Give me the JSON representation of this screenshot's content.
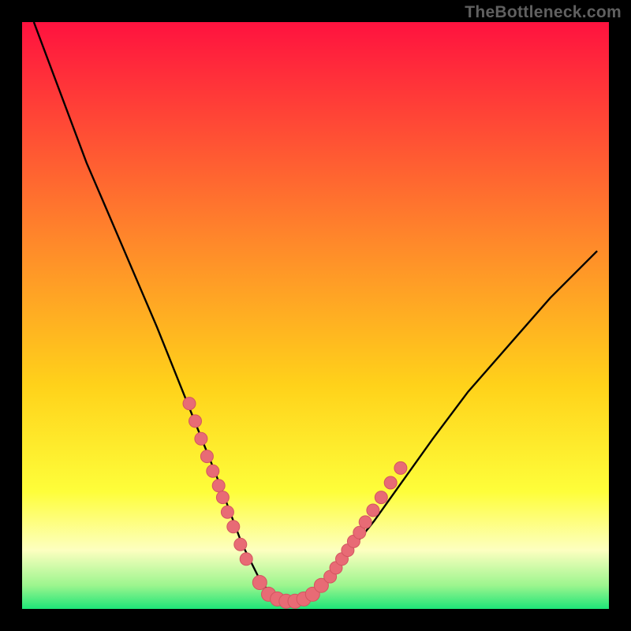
{
  "watermark": "TheBottleneck.com",
  "colors": {
    "gradient_top": "#ff123f",
    "gradient_mid1": "#ff7a2d",
    "gradient_mid2": "#ffd21a",
    "gradient_mid3": "#fefe3a",
    "gradient_pale": "#fdffc0",
    "gradient_green": "#1ee578",
    "curve": "#000000",
    "dot_fill": "#e86b75",
    "dot_stroke": "#d35560"
  },
  "chart_data": {
    "type": "line",
    "title": "",
    "xlabel": "",
    "ylabel": "",
    "xlim": [
      0,
      100
    ],
    "ylim": [
      0,
      100
    ],
    "series": [
      {
        "name": "bottleneck-curve",
        "x": [
          2,
          5,
          8,
          11,
          14,
          17,
          20,
          23,
          25,
          27,
          29,
          31,
          33,
          34.5,
          36,
          37.5,
          39,
          40.5,
          42,
          44,
          46,
          48,
          50,
          53,
          56,
          60,
          65,
          70,
          76,
          83,
          90,
          98
        ],
        "y": [
          100,
          92,
          84,
          76,
          69,
          62,
          55,
          48,
          43,
          38,
          33,
          28,
          23,
          19,
          15,
          11,
          8,
          5,
          3,
          1.5,
          1,
          1.5,
          3,
          6,
          10,
          15,
          22,
          29,
          37,
          45,
          53,
          61
        ]
      }
    ],
    "scatter": [
      {
        "name": "left-branch-dots",
        "points": [
          {
            "x": 28.5,
            "y": 35
          },
          {
            "x": 29.5,
            "y": 32
          },
          {
            "x": 30.5,
            "y": 29
          },
          {
            "x": 31.5,
            "y": 26
          },
          {
            "x": 32.5,
            "y": 23.5
          },
          {
            "x": 33.5,
            "y": 21
          },
          {
            "x": 34.2,
            "y": 19
          },
          {
            "x": 35,
            "y": 16.5
          },
          {
            "x": 36,
            "y": 14
          },
          {
            "x": 37.2,
            "y": 11
          },
          {
            "x": 38.2,
            "y": 8.5
          }
        ]
      },
      {
        "name": "trough-dots",
        "points": [
          {
            "x": 40.5,
            "y": 4.5
          },
          {
            "x": 42,
            "y": 2.5
          },
          {
            "x": 43.5,
            "y": 1.7
          },
          {
            "x": 45,
            "y": 1.3
          },
          {
            "x": 46.5,
            "y": 1.3
          },
          {
            "x": 48,
            "y": 1.7
          },
          {
            "x": 49.5,
            "y": 2.5
          },
          {
            "x": 51,
            "y": 4
          }
        ]
      },
      {
        "name": "right-branch-dots",
        "points": [
          {
            "x": 52.5,
            "y": 5.5
          },
          {
            "x": 53.5,
            "y": 7
          },
          {
            "x": 54.5,
            "y": 8.5
          },
          {
            "x": 55.5,
            "y": 10
          },
          {
            "x": 56.5,
            "y": 11.5
          },
          {
            "x": 57.5,
            "y": 13
          },
          {
            "x": 58.5,
            "y": 14.8
          },
          {
            "x": 59.8,
            "y": 16.8
          },
          {
            "x": 61.2,
            "y": 19
          },
          {
            "x": 62.8,
            "y": 21.5
          },
          {
            "x": 64.5,
            "y": 24
          }
        ]
      }
    ]
  }
}
